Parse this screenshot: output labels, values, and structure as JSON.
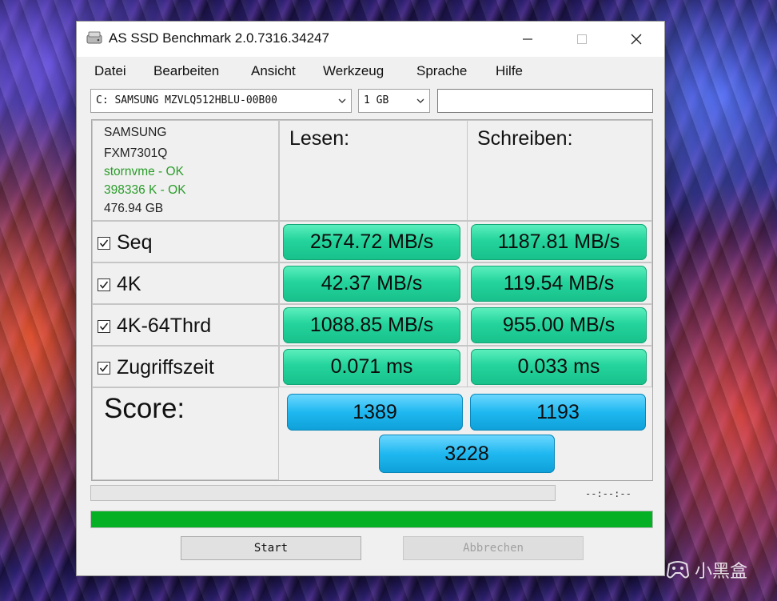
{
  "window": {
    "title": "AS SSD Benchmark 2.0.7316.34247",
    "icons": [
      "disk-icon",
      "minimize-icon",
      "maximize-icon",
      "close-icon"
    ]
  },
  "menu": {
    "items": [
      "Datei",
      "Bearbeiten",
      "Ansicht",
      "Werkzeug",
      "Sprache",
      "Hilfe"
    ]
  },
  "toolbar": {
    "drive_select": "C: SAMSUNG MZVLQ512HBLU-00B00",
    "size_select": "1 GB",
    "extra_input": ""
  },
  "drive_info": {
    "vendor": "SAMSUNG",
    "firmware": "FXM7301Q",
    "driver_status": "stornvme - OK",
    "alignment_status": "398336 K - OK",
    "capacity": "476.94 GB",
    "ok_color": "#2a9d2a"
  },
  "columns": {
    "read": "Lesen:",
    "write": "Schreiben:"
  },
  "rows": [
    {
      "label": "Seq",
      "checked": true,
      "read": "2574.72 MB/s",
      "write": "1187.81 MB/s"
    },
    {
      "label": "4K",
      "checked": true,
      "read": "42.37 MB/s",
      "write": "119.54 MB/s"
    },
    {
      "label": "4K-64Thrd",
      "checked": true,
      "read": "1088.85 MB/s",
      "write": "955.00 MB/s"
    },
    {
      "label": "Zugriffszeit",
      "checked": true,
      "read": "0.071 ms",
      "write": "0.033 ms"
    }
  ],
  "score": {
    "label": "Score:",
    "read": "1389",
    "write": "1193",
    "total": "3228"
  },
  "status": {
    "elapsed": "--:--:--",
    "progress_top_fraction": 0,
    "progress_bottom_fraction": 1.0,
    "progress_color": "#06b025"
  },
  "buttons": {
    "start": "Start",
    "abort": "Abbrechen"
  },
  "watermark": {
    "text": "小黑盒"
  }
}
